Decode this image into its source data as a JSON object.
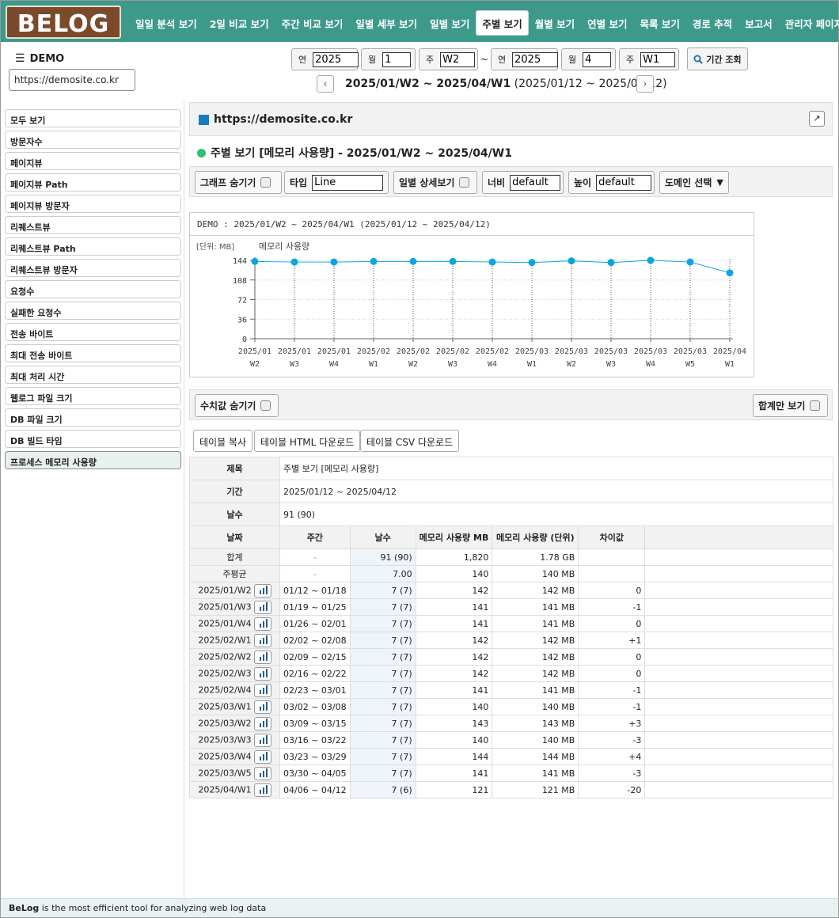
{
  "app": {
    "logo_text": "BELOG",
    "site_name": "DEMO",
    "site_url": "https://demosite.co.kr"
  },
  "nav": [
    {
      "label": "일일 분석 보기",
      "active": false
    },
    {
      "label": "2일 비교 보기",
      "active": false
    },
    {
      "label": "주간 비교 보기",
      "active": false
    },
    {
      "label": "일별 세부 보기",
      "active": false
    },
    {
      "label": "일별 보기",
      "active": false
    },
    {
      "label": "주별 보기",
      "active": true
    },
    {
      "label": "월별 보기",
      "active": false
    },
    {
      "label": "연별 보기",
      "active": false
    },
    {
      "label": "목록 보기",
      "active": false
    },
    {
      "label": "경로 추적",
      "active": false
    },
    {
      "label": "보고서",
      "active": false
    },
    {
      "label": "관리자 페이지",
      "active": false
    }
  ],
  "period": {
    "from": {
      "year_label": "연",
      "year": "2025",
      "month_label": "월",
      "month": "1",
      "week_label": "주",
      "week": "W2"
    },
    "tilde": "~",
    "to": {
      "year_label": "연",
      "year": "2025",
      "month_label": "월",
      "month": "4",
      "week_label": "주",
      "week": "W1"
    },
    "search_label": "기간 조회",
    "range_bold": "2025/01/W2 ~ 2025/04/W1",
    "range_dates": "(2025/01/12 ~ 2025/04/12)"
  },
  "sidebar": [
    "모두 보기",
    "방문자수",
    "페이지뷰",
    "페이지뷰 Path",
    "페이지뷰 방문자",
    "리퀘스트뷰",
    "리퀘스트뷰 Path",
    "리퀘스트뷰 방문자",
    "요청수",
    "실패한 요청수",
    "전송 바이트",
    "최대 전송 바이트",
    "최대 처리 시간",
    "웹로그 파일 크기",
    "DB 파일 크기",
    "DB 빌드 타임",
    "프로세스 메모리 사용량"
  ],
  "sidebar_active_index": 16,
  "panel": {
    "title": "https://demosite.co.kr",
    "view_title": "주별 보기 [메모리 사용량] - 2025/01/W2 ~ 2025/04/W1"
  },
  "options": {
    "hide_graph": "그래프 숨기기",
    "type_label": "타입",
    "type_value": "Line",
    "daily_detail": "일별 상세보기",
    "width_label": "너비",
    "width_value": "default",
    "height_label": "높이",
    "height_value": "default",
    "domain_select": "도메인 선택"
  },
  "chart_data": {
    "type": "line",
    "title": "DEMO : 2025/01/W2 ~ 2025/04/W1 (2025/01/12 ~ 2025/04/12)",
    "unit_label": "[단위: MB]",
    "series": [
      {
        "name": "메모리 사용량",
        "values": [
          142,
          141,
          141,
          142,
          142,
          142,
          141,
          140,
          143,
          140,
          144,
          141,
          121
        ]
      }
    ],
    "categories": [
      [
        "2025/01",
        "W2"
      ],
      [
        "2025/01",
        "W3"
      ],
      [
        "2025/01",
        "W4"
      ],
      [
        "2025/02",
        "W1"
      ],
      [
        "2025/02",
        "W2"
      ],
      [
        "2025/02",
        "W3"
      ],
      [
        "2025/02",
        "W4"
      ],
      [
        "2025/03",
        "W1"
      ],
      [
        "2025/03",
        "W2"
      ],
      [
        "2025/03",
        "W3"
      ],
      [
        "2025/03",
        "W4"
      ],
      [
        "2025/03",
        "W5"
      ],
      [
        "2025/04",
        "W1"
      ]
    ],
    "yticks": [
      "144",
      "108",
      "72",
      "36",
      "0"
    ],
    "ylim": [
      0,
      144
    ],
    "grid": true,
    "line_color": "#0aa6e0"
  },
  "value_bar": {
    "hide_values": "수치값 숨기기",
    "total_only": "합계만 보기"
  },
  "table_buttons": [
    "테이블 복사",
    "테이블 HTML 다운로드",
    "테이블 CSV 다운로드"
  ],
  "table": {
    "info": [
      {
        "label": "제목",
        "value": "주별 보기 [메모리 사용량]"
      },
      {
        "label": "기간",
        "value": "2025/01/12 ~ 2025/04/12"
      },
      {
        "label": "날수",
        "value": "91 (90)"
      }
    ],
    "headers": [
      "날짜",
      "주간",
      "날수",
      "메모리 사용량 MB",
      "메모리 사용량 (단위)",
      "차이값"
    ],
    "summary": [
      {
        "label": "합계",
        "week": "-",
        "days": "91 (90)",
        "mb": "1,820",
        "unit": "1.78 GB",
        "diff": ""
      },
      {
        "label": "주평균",
        "week": "-",
        "days": "7.00",
        "mb": "140",
        "unit": "140 MB",
        "diff": ""
      }
    ],
    "rows": [
      {
        "date": "2025/01/W2",
        "week": "01/12 ~ 01/18",
        "days": "7 (7)",
        "mb": "142",
        "unit": "142 MB",
        "diff": "0"
      },
      {
        "date": "2025/01/W3",
        "week": "01/19 ~ 01/25",
        "days": "7 (7)",
        "mb": "141",
        "unit": "141 MB",
        "diff": "-1"
      },
      {
        "date": "2025/01/W4",
        "week": "01/26 ~ 02/01",
        "days": "7 (7)",
        "mb": "141",
        "unit": "141 MB",
        "diff": "0"
      },
      {
        "date": "2025/02/W1",
        "week": "02/02 ~ 02/08",
        "days": "7 (7)",
        "mb": "142",
        "unit": "142 MB",
        "diff": "+1"
      },
      {
        "date": "2025/02/W2",
        "week": "02/09 ~ 02/15",
        "days": "7 (7)",
        "mb": "142",
        "unit": "142 MB",
        "diff": "0"
      },
      {
        "date": "2025/02/W3",
        "week": "02/16 ~ 02/22",
        "days": "7 (7)",
        "mb": "142",
        "unit": "142 MB",
        "diff": "0"
      },
      {
        "date": "2025/02/W4",
        "week": "02/23 ~ 03/01",
        "days": "7 (7)",
        "mb": "141",
        "unit": "141 MB",
        "diff": "-1"
      },
      {
        "date": "2025/03/W1",
        "week": "03/02 ~ 03/08",
        "days": "7 (7)",
        "mb": "140",
        "unit": "140 MB",
        "diff": "-1"
      },
      {
        "date": "2025/03/W2",
        "week": "03/09 ~ 03/15",
        "days": "7 (7)",
        "mb": "143",
        "unit": "143 MB",
        "diff": "+3"
      },
      {
        "date": "2025/03/W3",
        "week": "03/16 ~ 03/22",
        "days": "7 (7)",
        "mb": "140",
        "unit": "140 MB",
        "diff": "-3"
      },
      {
        "date": "2025/03/W4",
        "week": "03/23 ~ 03/29",
        "days": "7 (7)",
        "mb": "144",
        "unit": "144 MB",
        "diff": "+4"
      },
      {
        "date": "2025/03/W5",
        "week": "03/30 ~ 04/05",
        "days": "7 (7)",
        "mb": "141",
        "unit": "141 MB",
        "diff": "-3"
      },
      {
        "date": "2025/04/W1",
        "week": "04/06 ~ 04/12",
        "days": "7 (6)",
        "mb": "121",
        "unit": "121 MB",
        "diff": "-20"
      }
    ]
  },
  "footer": {
    "brand": "BeLog",
    "text": " is the most efficient tool for analyzing web log data"
  }
}
